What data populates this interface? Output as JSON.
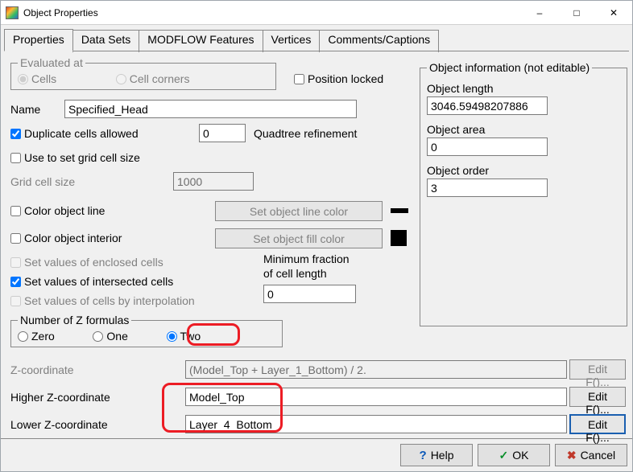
{
  "window": {
    "title": "Object Properties"
  },
  "tabs": [
    "Properties",
    "Data Sets",
    "MODFLOW Features",
    "Vertices",
    "Comments/Captions"
  ],
  "eval": {
    "legend": "Evaluated at",
    "cells": "Cells",
    "corners": "Cell corners"
  },
  "position_locked": "Position locked",
  "name_label": "Name",
  "name_value": "Specified_Head",
  "dup_cells": "Duplicate cells allowed",
  "quad_value": "0",
  "quad_label": "Quadtree refinement",
  "use_grid": "Use to set grid cell size",
  "gridcell_label": "Grid cell size",
  "gridcell_value": "1000",
  "color_line": "Color object line",
  "set_line_color": "Set object line color",
  "color_interior": "Color object interior",
  "set_fill_color": "Set object fill color",
  "sv_enclosed": "Set values of enclosed cells",
  "sv_intersected": "Set values of intersected cells",
  "sv_interp": "Set values of cells by interpolation",
  "minfrac_label1": "Minimum fraction",
  "minfrac_label2": "of cell length",
  "minfrac_value": "0",
  "nz": {
    "legend": "Number of Z formulas",
    "zero": "Zero",
    "one": "One",
    "two": "Two"
  },
  "zc_label": "Z-coordinate",
  "zc_value": "(Model_Top + Layer_1_Bottom) / 2.",
  "hz_label": "Higher Z-coordinate",
  "hz_value": "Model_Top",
  "lz_label": "Lower Z-coordinate",
  "lz_value": "Layer_4_Bottom",
  "editf": "Edit F()...",
  "objinfo": {
    "legend": "Object information (not editable)",
    "len_label": "Object length",
    "len_value": "3046.59498207886",
    "area_label": "Object area",
    "area_value": "0",
    "order_label": "Object order",
    "order_value": "3"
  },
  "footer": {
    "help": "Help",
    "ok": "OK",
    "cancel": "Cancel"
  }
}
